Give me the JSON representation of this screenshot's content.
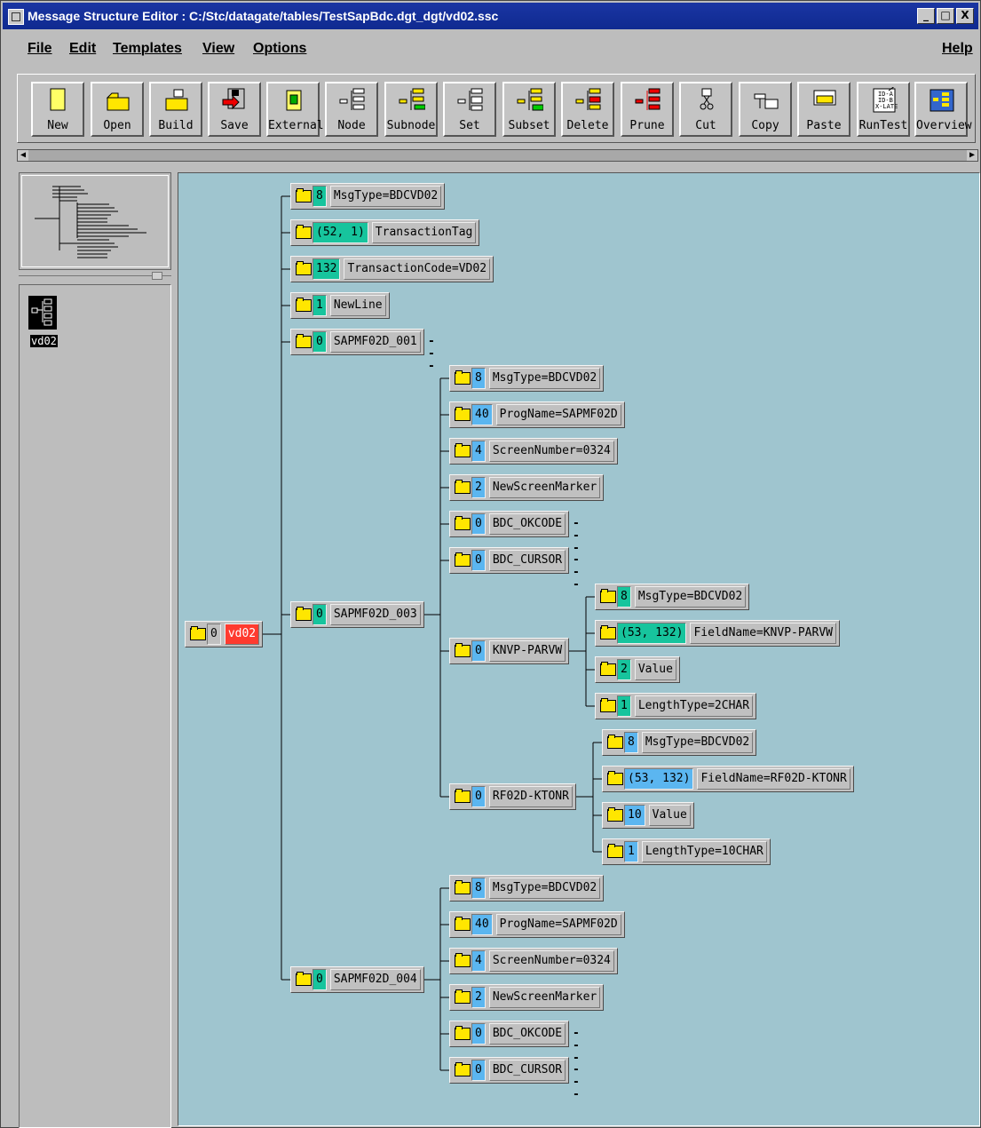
{
  "window": {
    "title": "Message Structure Editor : C:/Stc/datagate/tables/TestSapBdc.dgt_dgt/vd02.ssc",
    "buttons": [
      "_",
      "□",
      "X"
    ]
  },
  "menu": {
    "file": "File",
    "edit": "Edit",
    "templates": "Templates",
    "view": "View",
    "options": "Options",
    "help": "Help"
  },
  "toolbar": [
    {
      "id": "new",
      "label": "New"
    },
    {
      "id": "open",
      "label": "Open"
    },
    {
      "id": "build",
      "label": "Build"
    },
    {
      "id": "save",
      "label": "Save"
    },
    {
      "id": "external",
      "label": "External"
    },
    {
      "id": "node",
      "label": "Node"
    },
    {
      "id": "subnode",
      "label": "Subnode"
    },
    {
      "id": "set",
      "label": "Set"
    },
    {
      "id": "subset",
      "label": "Subset"
    },
    {
      "id": "delete",
      "label": "Delete"
    },
    {
      "id": "prune",
      "label": "Prune"
    },
    {
      "id": "cut",
      "label": "Cut"
    },
    {
      "id": "copy",
      "label": "Copy"
    },
    {
      "id": "paste",
      "label": "Paste"
    },
    {
      "id": "runtest",
      "label": "RunTest"
    },
    {
      "id": "overview",
      "label": "Overview"
    }
  ],
  "left_panel": {
    "message_label": "vd02"
  },
  "tree": {
    "id": "root",
    "num": "0",
    "color": "gray",
    "name": "vd02",
    "red": true,
    "children": [
      {
        "id": "a1",
        "num": "8",
        "color": "teal",
        "name": "MsgType=BDCVD02"
      },
      {
        "id": "a2",
        "num": "(52, 1)",
        "color": "teal",
        "name": "TransactionTag"
      },
      {
        "id": "a3",
        "num": "132",
        "color": "teal",
        "name": "TransactionCode=VD02"
      },
      {
        "id": "a4",
        "num": "1",
        "color": "teal",
        "name": "NewLine"
      },
      {
        "id": "a5",
        "num": "0",
        "color": "teal",
        "name": "SAPMF02D_001",
        "collapsed": true
      },
      {
        "id": "a6",
        "num": "0",
        "color": "teal",
        "name": "SAPMF02D_003",
        "children": [
          {
            "id": "b1",
            "num": "8",
            "color": "blue",
            "name": "MsgType=BDCVD02"
          },
          {
            "id": "b2",
            "num": "40",
            "color": "blue",
            "name": "ProgName=SAPMF02D"
          },
          {
            "id": "b3",
            "num": "4",
            "color": "blue",
            "name": "ScreenNumber=0324"
          },
          {
            "id": "b4",
            "num": "2",
            "color": "blue",
            "name": "NewScreenMarker"
          },
          {
            "id": "b5",
            "num": "0",
            "color": "blue",
            "name": "BDC_OKCODE",
            "collapsed": true
          },
          {
            "id": "b6",
            "num": "0",
            "color": "blue",
            "name": "BDC_CURSOR",
            "collapsed": true
          },
          {
            "id": "b7",
            "num": "0",
            "color": "blue",
            "name": "KNVP-PARVW",
            "children": [
              {
                "id": "c1",
                "num": "8",
                "color": "teal",
                "name": "MsgType=BDCVD02"
              },
              {
                "id": "c2",
                "num": "(53, 132)",
                "color": "teal",
                "name": "FieldName=KNVP-PARVW"
              },
              {
                "id": "c3",
                "num": "2",
                "color": "teal",
                "name": "Value"
              },
              {
                "id": "c4",
                "num": "1",
                "color": "teal",
                "name": "LengthType=2CHAR"
              }
            ]
          },
          {
            "id": "b8",
            "num": "0",
            "color": "blue",
            "name": "RF02D-KTONR",
            "children": [
              {
                "id": "d1",
                "num": "8",
                "color": "blue",
                "name": "MsgType=BDCVD02"
              },
              {
                "id": "d2",
                "num": "(53, 132)",
                "color": "blue",
                "name": "FieldName=RF02D-KTONR"
              },
              {
                "id": "d3",
                "num": "10",
                "color": "blue",
                "name": "Value"
              },
              {
                "id": "d4",
                "num": "1",
                "color": "blue",
                "name": "LengthType=10CHAR"
              }
            ]
          }
        ]
      },
      {
        "id": "a7",
        "num": "0",
        "color": "teal",
        "name": "SAPMF02D_004",
        "children": [
          {
            "id": "e1",
            "num": "8",
            "color": "blue",
            "name": "MsgType=BDCVD02"
          },
          {
            "id": "e2",
            "num": "40",
            "color": "blue",
            "name": "ProgName=SAPMF02D"
          },
          {
            "id": "e3",
            "num": "4",
            "color": "blue",
            "name": "ScreenNumber=0324"
          },
          {
            "id": "e4",
            "num": "2",
            "color": "blue",
            "name": "NewScreenMarker"
          },
          {
            "id": "e5",
            "num": "0",
            "color": "blue",
            "name": "BDC_OKCODE",
            "collapsed": true
          },
          {
            "id": "e6",
            "num": "0",
            "color": "blue",
            "name": "BDC_CURSOR",
            "collapsed": true
          }
        ]
      }
    ]
  },
  "collapsed_marker": "---",
  "colors": {
    "canvas": "#9fc5cf",
    "teal_badge": "#17c49d",
    "blue_badge": "#5bb6f0",
    "selected": "#ff3b2f",
    "folder": "#ffe600",
    "titlebar": "#1a35a3"
  }
}
